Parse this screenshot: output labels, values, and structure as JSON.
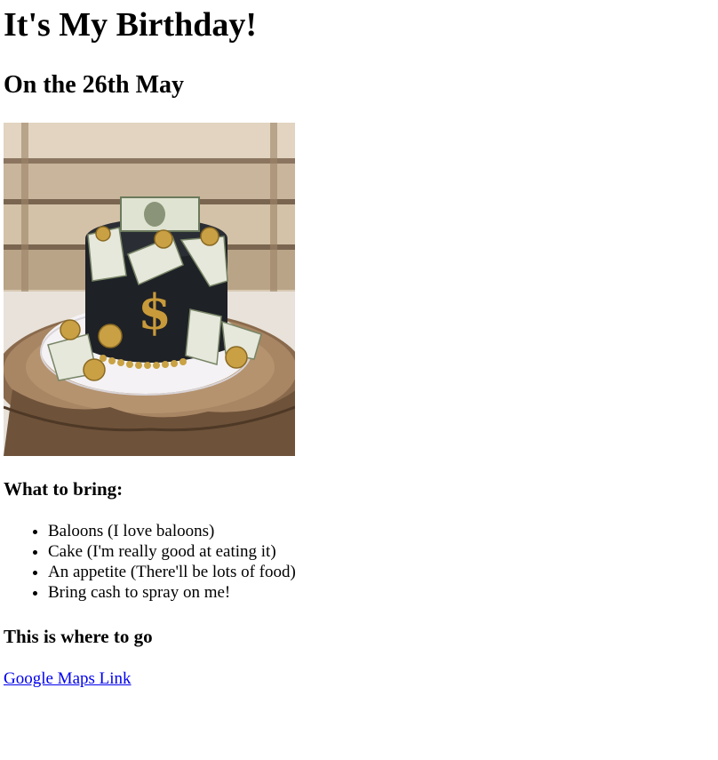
{
  "header": {
    "title": "It's My Birthday!",
    "subtitle": "On the 26th May"
  },
  "image": {
    "icon": "birthday-cake-photo"
  },
  "bring": {
    "heading": "What to bring:",
    "items": [
      "Baloons (I love baloons)",
      "Cake (I'm really good at eating it)",
      "An appetite (There'll be lots of food)",
      "Bring cash to spray on me!"
    ]
  },
  "location": {
    "heading": "This is where to go",
    "link_label": "Google Maps Link"
  },
  "colors": {
    "link": "#0000ee",
    "text": "#000000",
    "background": "#ffffff"
  }
}
